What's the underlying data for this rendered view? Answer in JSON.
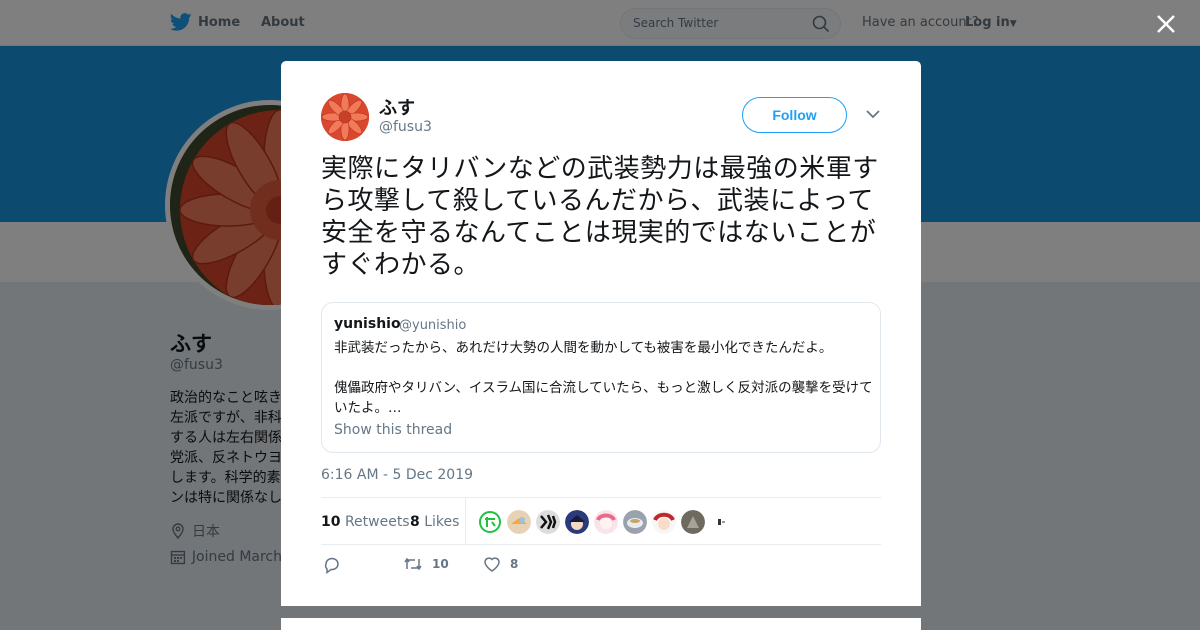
{
  "topbar": {
    "home_label": "Home",
    "about_label": "About",
    "search_placeholder": "Search Twitter",
    "have_account": "Have an account?",
    "login_label": "Log in"
  },
  "profile": {
    "name": "ふす",
    "handle": "@fusu3",
    "bio_lines": [
      "政治的なこと呟き",
      "左派ですが、非科",
      "する人は左右関係",
      "党派、反ネトウヨ",
      "します。科学的素",
      "ンは特に関係なし"
    ],
    "location": "日本",
    "joined": "Joined March"
  },
  "tweet": {
    "author_name": "ふす",
    "author_handle": "@fusu3",
    "follow_label": "Follow",
    "text": "実際にタリバンなどの武装勢力は最強の米軍すら攻撃して殺しているんだから、武装によって安全を守るなんてことは現実的ではないことがすぐわかる。",
    "quote": {
      "name": "yunishio",
      "handle": "@yunishio",
      "text": "非武装だったから、あれだけ大勢の人間を動かしても被害を最小化できたんだよ。\n\n傀儡政府やタリバン、イスラム国に合流していたら、もっと激しく反対派の襲撃を受けていたよ。…",
      "thread_link": "Show this thread"
    },
    "timestamp": "6:16 AM - 5 Dec 2019",
    "retweets_count": "10",
    "retweets_label": "Retweets",
    "likes_count": "8",
    "likes_label": "Likes",
    "action_retweet_count": "10",
    "action_like_count": "8"
  },
  "colors": {
    "brand": "#1da1f2",
    "banner": "#1b95e0",
    "secondary_text": "#657786"
  }
}
